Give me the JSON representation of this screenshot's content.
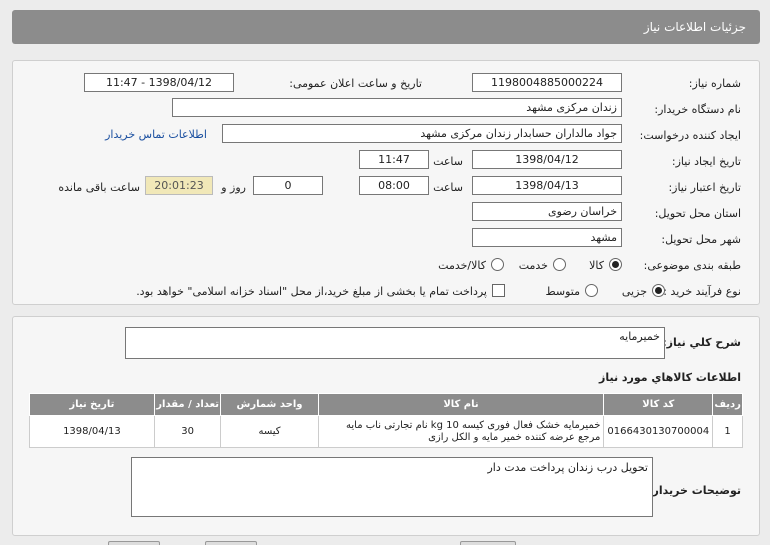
{
  "header": {
    "title": "جزئیات اطلاعات نیاز"
  },
  "form": {
    "need_number_label": "شماره نیاز:",
    "need_number": "1198004885000224",
    "announce_label": "تاریخ و ساعت اعلان عمومی:",
    "announce_value": "1398/04/12 - 11:47",
    "buyer_org_label": "نام دستگاه خریدار:",
    "buyer_org": "زندان مرکزی مشهد",
    "requester_label": "ایجاد کننده درخواست:",
    "requester": "جواد مالداران حسابدار زندان مرکزی مشهد",
    "contact_link": "اطلاعات تماس خریدار",
    "created_label": "تاریخ ایجاد نیاز:",
    "created_date": "1398/04/12",
    "time_label": "ساعت",
    "created_time": "11:47",
    "validity_label": "تاریخ اعتبار نیاز:",
    "validity_date": "1398/04/13",
    "validity_time": "08:00",
    "days_value": "0",
    "days_label": "روز و",
    "remaining_time": "20:01:23",
    "remaining_label": "ساعت باقی مانده",
    "province_label": "استان محل تحویل:",
    "province": "خراسان رضوی",
    "city_label": "شهر محل تحویل:",
    "city": "مشهد",
    "category_label": "طبقه بندی موضوعی:",
    "category_options": [
      "کالا",
      "خدمت",
      "کالا/خدمت"
    ],
    "category_selected": "کالا",
    "process_label": "نوع فرآیند خرید :",
    "process_options": [
      "جزیی",
      "متوسط"
    ],
    "process_selected": "جزیی",
    "treasury_note": "پرداخت تمام یا بخشی از مبلغ خرید،از محل \"اسناد خزانه اسلامی\" خواهد بود."
  },
  "summary": {
    "label": "شرح كلي نياز:",
    "value": "خمیرمایه"
  },
  "goods": {
    "title": "اطلاعات كالاهاي مورد نياز",
    "columns": [
      "ردیف",
      "کد کالا",
      "نام کالا",
      "واحد شمارش",
      "تعداد / مقدار",
      "تاریخ نیاز"
    ],
    "rows": [
      {
        "row": "1",
        "code": "0166430130700004",
        "name": "خمیرمایه خشک فعال فوری کیسه kg 10 نام تجارتی ناب مایه مرجع عرضه کننده خمیر مایه و الکل رازی",
        "unit": "کیسه",
        "qty": "30",
        "date": "1398/04/13"
      }
    ]
  },
  "buyer_notes": {
    "label": "توضیحات خریدار:",
    "value": "تحویل درب زندان پرداخت مدت دار"
  }
}
